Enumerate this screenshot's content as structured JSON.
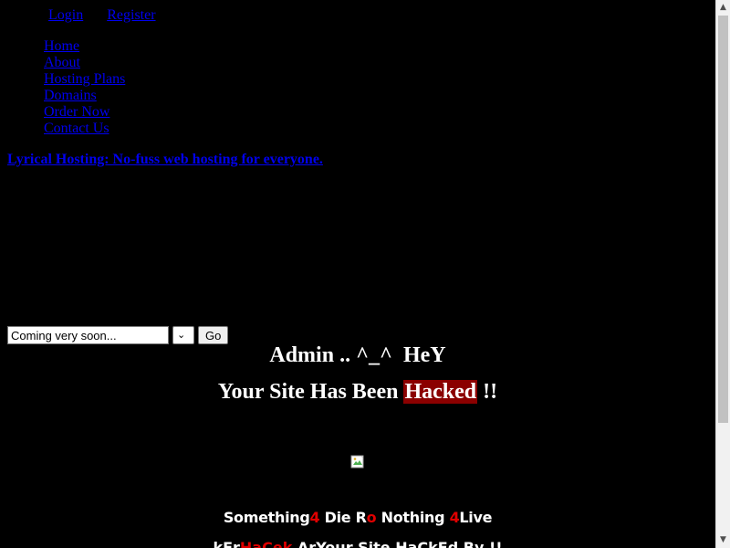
{
  "top_links": {
    "login": "Login",
    "register": "Register"
  },
  "nav": {
    "items": [
      "Home",
      "About",
      "Hosting Plans",
      "Domains",
      "Order Now",
      "Contact Us"
    ]
  },
  "tagline": "Lyrical Hosting: No-fuss web hosting for everyone.",
  "domain_form": {
    "input_value": "Coming very soon...",
    "go_label": "Go"
  },
  "hack_message": {
    "line1": "Admin .. ^_^  HeY",
    "line2_prefix": "Your Site Has Been ",
    "line2_highlight": "Hacked",
    "line2_suffix": " !!"
  },
  "slogan": {
    "part1": "Something",
    "part2": "4",
    "part3": " Die R",
    "part4": "o",
    "part5": " Nothing ",
    "part6": "4",
    "part7": "Live"
  },
  "bottom_line": {
    "part1": "kEr",
    "part2": "HaC",
    "part3": "ek",
    "part4": " ArYour Site HaCkEd By !!"
  },
  "colors": {
    "background": "#000000",
    "link": "#0000ee",
    "highlight": "#8b0000",
    "accent_red": "#e00000"
  }
}
